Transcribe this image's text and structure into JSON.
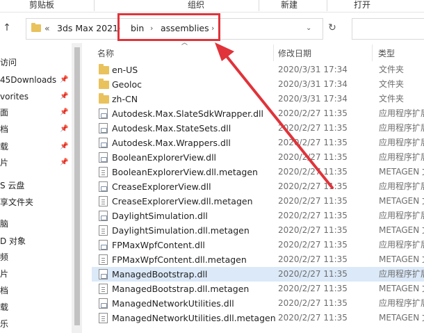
{
  "ribbon": {
    "clipboard": "剪贴板",
    "organize": "组织",
    "new": "新建",
    "open": "打开"
  },
  "address": {
    "prefix": "«",
    "crumbs": [
      "3ds Max 2021",
      "bin",
      "assemblies"
    ]
  },
  "nav_pane": {
    "items": [
      {
        "label": "访问",
        "pinned": false
      },
      {
        "label": "45Downloads",
        "pinned": true
      },
      {
        "label": "vorites",
        "pinned": true
      },
      {
        "label": "面",
        "pinned": true
      },
      {
        "label": "档",
        "pinned": true
      },
      {
        "label": "载",
        "pinned": true
      },
      {
        "label": "片",
        "pinned": true
      },
      {
        "label": "S 云盘",
        "pinned": false
      },
      {
        "label": "享文件夹",
        "pinned": false
      },
      {
        "label": "脑",
        "pinned": false
      },
      {
        "label": "D 对象",
        "pinned": false
      },
      {
        "label": "频",
        "pinned": false
      },
      {
        "label": "片",
        "pinned": false
      },
      {
        "label": "档",
        "pinned": false
      },
      {
        "label": "载",
        "pinned": false
      },
      {
        "label": "乐",
        "pinned": false
      }
    ]
  },
  "columns": {
    "name": "名称",
    "modified": "修改日期",
    "type": "类型"
  },
  "files": [
    {
      "name": "en-US",
      "modified": "2020/3/31 17:34",
      "type": "文件夹",
      "icon": "folder"
    },
    {
      "name": "Geoloc",
      "modified": "2020/3/31 17:34",
      "type": "文件夹",
      "icon": "folder"
    },
    {
      "name": "zh-CN",
      "modified": "2020/3/31 17:34",
      "type": "文件夹",
      "icon": "folder"
    },
    {
      "name": "Autodesk.Max.SlateSdkWrapper.dll",
      "modified": "2020/2/27 11:35",
      "type": "应用程序扩展",
      "icon": "dll"
    },
    {
      "name": "Autodesk.Max.StateSets.dll",
      "modified": "2020/2/27 11:35",
      "type": "应用程序扩展",
      "icon": "dll"
    },
    {
      "name": "Autodesk.Max.Wrappers.dll",
      "modified": "2020/2/27 11:35",
      "type": "应用程序扩展",
      "icon": "dll"
    },
    {
      "name": "BooleanExplorerView.dll",
      "modified": "2020/2/27 11:35",
      "type": "应用程序扩展",
      "icon": "dll"
    },
    {
      "name": "BooleanExplorerView.dll.metagen",
      "modified": "2020/2/27 11:35",
      "type": "METAGEN 文",
      "icon": "doc"
    },
    {
      "name": "CreaseExplorerView.dll",
      "modified": "2020/2/27 11:35",
      "type": "应用程序扩展",
      "icon": "dll"
    },
    {
      "name": "CreaseExplorerView.dll.metagen",
      "modified": "2020/2/27 11:35",
      "type": "METAGEN 文",
      "icon": "doc"
    },
    {
      "name": "DaylightSimulation.dll",
      "modified": "2020/2/27 11:35",
      "type": "应用程序扩展",
      "icon": "dll"
    },
    {
      "name": "DaylightSimulation.dll.metagen",
      "modified": "2020/2/27 11:35",
      "type": "METAGEN 文",
      "icon": "doc"
    },
    {
      "name": "FPMaxWpfContent.dll",
      "modified": "2020/2/27 11:35",
      "type": "应用程序扩展",
      "icon": "dll"
    },
    {
      "name": "FPMaxWpfContent.dll.metagen",
      "modified": "2020/2/27 11:35",
      "type": "METAGEN 文",
      "icon": "doc"
    },
    {
      "name": "ManagedBootstrap.dll",
      "modified": "2020/2/27 11:35",
      "type": "应用程序扩展",
      "icon": "dll",
      "selected": true
    },
    {
      "name": "ManagedBootstrap.dll.metagen",
      "modified": "2020/2/27 11:35",
      "type": "METAGEN 文",
      "icon": "doc"
    },
    {
      "name": "ManagedNetworkUtilities.dll",
      "modified": "2020/2/27 11:35",
      "type": "应用程序扩展",
      "icon": "dll"
    },
    {
      "name": "ManagedNetworkUtilities.dll.metagen",
      "modified": "2020/2/27 11:35",
      "type": "METAGEN 文",
      "icon": "doc"
    }
  ],
  "colors": {
    "annotation_red": "#e0333a",
    "selection": "#dbe9f8",
    "folder": "#e9c25c"
  }
}
